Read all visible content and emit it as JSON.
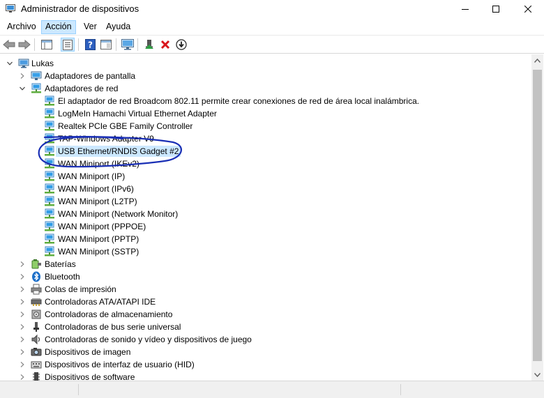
{
  "window": {
    "title": "Administrador de dispositivos"
  },
  "menu": {
    "items": [
      "Archivo",
      "Acción",
      "Ver",
      "Ayuda"
    ],
    "active_index": 1
  },
  "tree": {
    "root": "Lukas",
    "categories": {
      "display": "Adaptadores de pantalla",
      "network": "Adaptadores de red",
      "batteries": "Baterías",
      "bluetooth": "Bluetooth",
      "print_queues": "Colas de impresión",
      "ata": "Controladoras ATA/ATAPI IDE",
      "storage": "Controladoras de almacenamiento",
      "usb": "Controladoras de bus serie universal",
      "sound": "Controladoras de sonido y vídeo y dispositivos de juego",
      "imaging": "Dispositivos de imagen",
      "hid": "Dispositivos de interfaz de usuario (HID)",
      "software": "Dispositivos de software"
    },
    "network_adapters": [
      "El adaptador de red Broadcom 802.11 permite crear conexiones de red de área local inalámbrica.",
      "LogMeIn Hamachi Virtual Ethernet Adapter",
      "Realtek PCIe GBE Family Controller",
      "TAP-Windows Adapter V9",
      "USB Ethernet/RNDIS Gadget #2",
      "WAN Miniport (IKEv2)",
      "WAN Miniport (IP)",
      "WAN Miniport (IPv6)",
      "WAN Miniport (L2TP)",
      "WAN Miniport (Network Monitor)",
      "WAN Miniport (PPPOE)",
      "WAN Miniport (PPTP)",
      "WAN Miniport (SSTP)"
    ],
    "selected_adapter_index": 4
  },
  "colors": {
    "selection": "#cce8ff",
    "annotation_ink": "#1a2fb5",
    "uninstall_red": "#d9141b"
  }
}
